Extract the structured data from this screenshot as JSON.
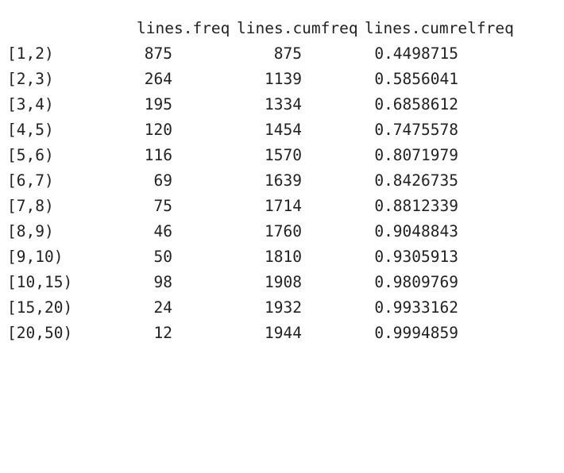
{
  "table": {
    "headers": [
      "lines.freq",
      "lines.cumfreq",
      "lines.cumrelfreq"
    ],
    "rows": [
      {
        "label": "[1,2)",
        "freq": "875",
        "cumfreq": "875",
        "cumrelfreq": "0.4498715"
      },
      {
        "label": "[2,3)",
        "freq": "264",
        "cumfreq": "1139",
        "cumrelfreq": "0.5856041"
      },
      {
        "label": "[3,4)",
        "freq": "195",
        "cumfreq": "1334",
        "cumrelfreq": "0.6858612"
      },
      {
        "label": "[4,5)",
        "freq": "120",
        "cumfreq": "1454",
        "cumrelfreq": "0.7475578"
      },
      {
        "label": "[5,6)",
        "freq": "116",
        "cumfreq": "1570",
        "cumrelfreq": "0.8071979"
      },
      {
        "label": "[6,7)",
        "freq": "69",
        "cumfreq": "1639",
        "cumrelfreq": "0.8426735"
      },
      {
        "label": "[7,8)",
        "freq": "75",
        "cumfreq": "1714",
        "cumrelfreq": "0.8812339"
      },
      {
        "label": "[8,9)",
        "freq": "46",
        "cumfreq": "1760",
        "cumrelfreq": "0.9048843"
      },
      {
        "label": "[9,10)",
        "freq": "50",
        "cumfreq": "1810",
        "cumrelfreq": "0.9305913"
      },
      {
        "label": "[10,15)",
        "freq": "98",
        "cumfreq": "1908",
        "cumrelfreq": "0.9809769"
      },
      {
        "label": "[15,20)",
        "freq": "24",
        "cumfreq": "1932",
        "cumrelfreq": "0.9933162"
      },
      {
        "label": "[20,50)",
        "freq": "12",
        "cumfreq": "1944",
        "cumrelfreq": "0.9994859"
      }
    ]
  }
}
